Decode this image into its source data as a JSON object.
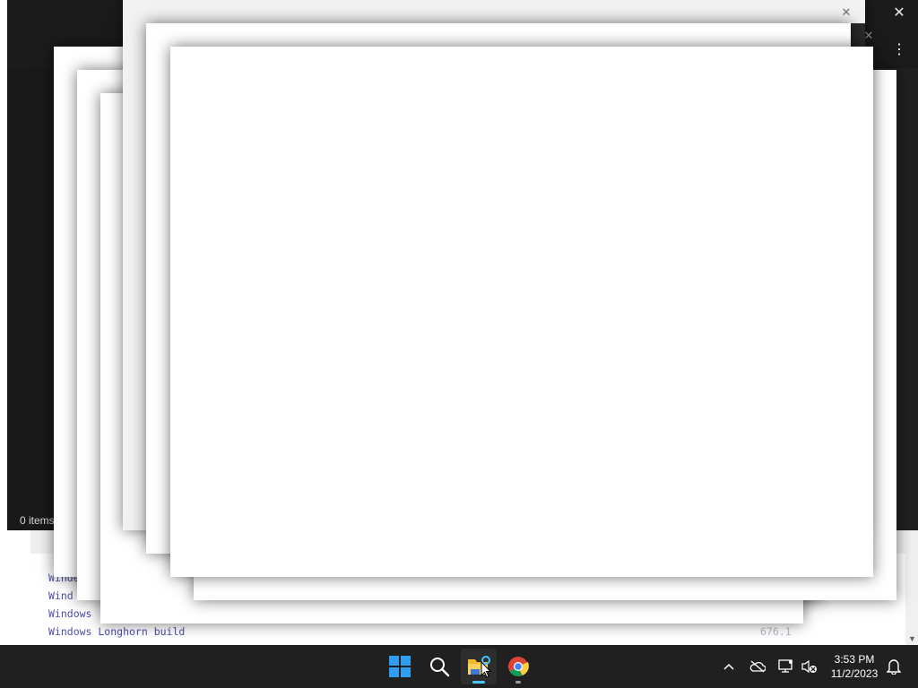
{
  "explorer": {
    "status_items": "0 items",
    "close_glyph": "✕",
    "more_glyph": "⋮"
  },
  "background_page": {
    "links": [
      "Winde",
      "Wind",
      "Windows",
      "Windows Longhorn build"
    ],
    "faded_right": "676.1"
  },
  "taskbar": {
    "apps": [
      {
        "name": "Start",
        "icon": "windows-logo-icon"
      },
      {
        "name": "Search",
        "icon": "search-icon"
      },
      {
        "name": "File Explorer",
        "icon": "folder-icon",
        "active": true
      },
      {
        "name": "Google Chrome",
        "icon": "chrome-icon",
        "running": true
      }
    ],
    "tray": {
      "chevron": "^",
      "time": "3:53 PM",
      "date": "11/2/2023"
    }
  },
  "colors": {
    "taskbar_bg": "#202020",
    "accent": "#4cc2ff",
    "start_blue": "#2f9df0"
  }
}
